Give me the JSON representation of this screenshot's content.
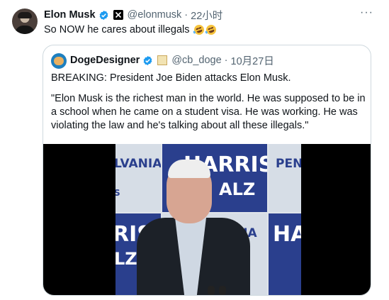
{
  "tweet": {
    "author_name": "Elon Musk",
    "handle": "@elonmusk",
    "separator": "·",
    "time": "22小时",
    "more_icon": "more-horizontal-icon",
    "text": "So NOW he cares about illegals",
    "emojis": [
      "rolling-on-floor-laughing",
      "rolling-on-floor-laughing"
    ]
  },
  "quoted": {
    "author_name": "DogeDesigner",
    "handle": "@cb_doge",
    "separator": "·",
    "date": "10月27日",
    "headline": "BREAKING: President Joe Biden attacks Elon Musk.",
    "quote": "\"Elon Musk is the richest man in the world. He was supposed to be in a school when he came on a student visa. He was working. He was violating the law and he's talking about all these illegals.\""
  },
  "video_signs": {
    "top_left": "LVANIA",
    "top_center_1": "HARRIS",
    "top_center_2": "ALZ",
    "top_right": "PEN",
    "mid_left_1": "RIS",
    "mid_left_2": "LZ",
    "mid_center": "NIA",
    "mid_right": "HA",
    "small_left": "S"
  },
  "colors": {
    "verified_blue": "#1d9bf0",
    "secondary_text": "#536471",
    "border": "#cfd9de",
    "sign_blue": "#2a3f8d"
  }
}
